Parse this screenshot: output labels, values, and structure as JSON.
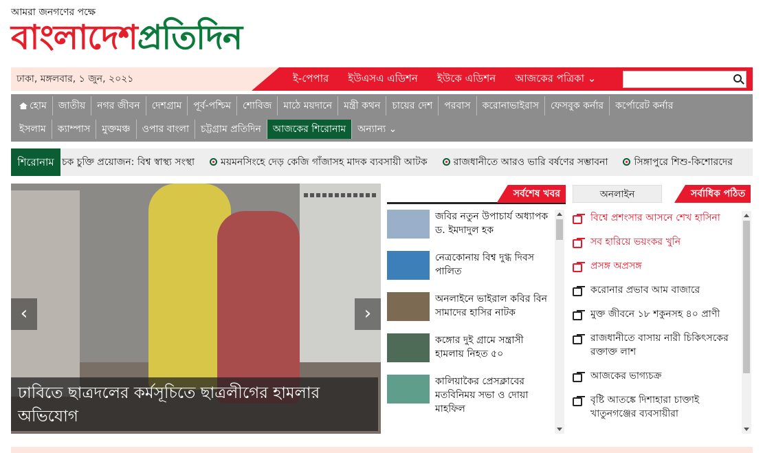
{
  "header": {
    "tagline": "আমরা জনগণের পক্ষে",
    "logo_part1": "বাংলাদেশ",
    "logo_part2": "প্রতিদিন"
  },
  "topbar": {
    "date": "ঢাকা, মঙ্গলবার, ১ জুন, ২০২১",
    "links": [
      "ই-পেপার",
      "ইউএসএ এডিশন",
      "ইউকে এডিশন",
      "আজকের পত্রিকা ⌄"
    ],
    "search_placeholder": ""
  },
  "nav": {
    "row1": [
      "হোম",
      "জাতীয়",
      "নগর জীবন",
      "দেশগ্রাম",
      "পূর্ব-পশ্চিম",
      "শোবিজ",
      "মাঠে ময়দানে",
      "মন্ত্রী কথন",
      "চায়ের দেশ",
      "পরবাস",
      "করোনাভাইরাস",
      "ফেসবুক কর্নার",
      "কর্পোরেট কর্নার"
    ],
    "row2": [
      "ইসলাম",
      "ক্যাম্পাস",
      "মুক্তমঞ্চ",
      "ওপার বাংলা",
      "চট্টগ্রাম প্রতিদিন",
      "আজকের শিরোনাম",
      "অন্যান্য ⌄"
    ],
    "active_index": 5
  },
  "ticker": {
    "label": "শিরোনাম",
    "items": [
      "চক চুক্তি প্রয়োজন: বিশ্ব স্বাস্থ্য সংস্থা",
      "ময়মনসিংহে দেড় কেজি গাঁজাসহ মাদক ব্যবসায়ী আটক",
      "রাজধানীতে আরও ভারি বর্ষণের সম্ভাবনা",
      "সিঙ্গাপুরে শিশু-কিশোরদের"
    ]
  },
  "hero": {
    "caption": "ঢাবিতে ছাত্রদলের কর্মসূচিতে ছাত্রলীগের হামলার অভিযোগ",
    "prev": "‹",
    "next": "›"
  },
  "latest": {
    "title": "সর্বশেষ খবর",
    "items": [
      {
        "text": "জবির নতুন উপাচার্য অধ্যাপক ড. ইমদাদুল হক",
        "color": "#9ab0c8"
      },
      {
        "text": "নেত্রকোনায় বিশ্ব দুগ্ধ দিবস পালিত",
        "color": "#3d7fb8"
      },
      {
        "text": "অনলাইনে ভাইরাল কবির বিন সামাদের হাসির নাটক",
        "color": "#7c6a52"
      },
      {
        "text": "কঙ্গোর দুই গ্রামে সন্ত্রাসী হামলায় নিহত ৫০",
        "color": "#4e6b58"
      },
      {
        "text": "কালিয়াকৈর প্রেসক্লাবের মতবিনিময় সভা ও দোয়া মাহফিল",
        "color": "#5f9e8a"
      }
    ]
  },
  "popular": {
    "tab_online": "অনলাইন",
    "tab_popular": "সর্বাধিক পঠিত",
    "items": [
      {
        "text": "বিশ্বে প্রশংসার আসনে শেখ হাসিনা",
        "red": true
      },
      {
        "text": "সব হারিয়ে ভয়ংকর খুনি",
        "red": true
      },
      {
        "text": "প্রসঙ্গ অপ্রসঙ্গ",
        "red": true
      },
      {
        "text": "করোনার প্রভাব আম বাজারে",
        "red": false
      },
      {
        "text": "মুক্ত জীবনে ১৮ শকুনসহ ৪০ প্রাণী",
        "red": false
      },
      {
        "text": "রাজধানীতে বাসায় নারী চিকিৎসকের রক্তাক্ত লাশ",
        "red": false
      },
      {
        "text": "আজকের ভাগ্যচক্র",
        "red": false
      },
      {
        "text": "বৃষ্টি আতঙ্কে দিশাহারা চাক্তাই খাতুনগঞ্জের ব্যবসায়ীরা",
        "red": false
      }
    ]
  },
  "colors": {
    "brand_red": "#e8192c",
    "brand_green": "#0b5e34",
    "nav_grey": "#8d8d8d"
  }
}
